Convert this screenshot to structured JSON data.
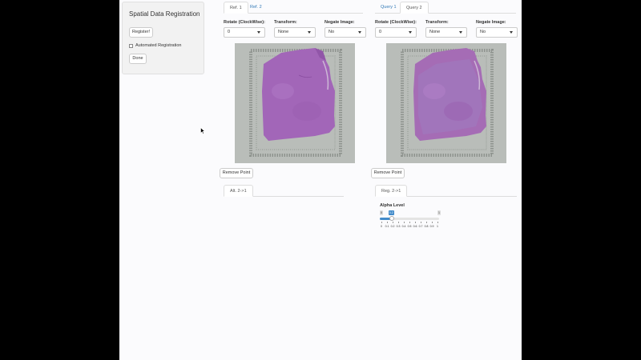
{
  "sidebar": {
    "title": "Spatial Data Registration",
    "register_label": "Register!",
    "automated_label": "Automated Registration",
    "done_label": "Done"
  },
  "reference": {
    "tabs": [
      "Ref. 1",
      "Ref. 2"
    ],
    "active_tab": 0,
    "rotate_label": "Rotate (ClockWise):",
    "rotate_value": "0",
    "transform_label": "Transform:",
    "transform_value": "None",
    "negate_label": "Negate Image:",
    "negate_value": "No",
    "remove_point_label": "Remove Point",
    "result_tab": "Alt. 2->1"
  },
  "query": {
    "tabs": [
      "Query 1",
      "Query 2"
    ],
    "active_tab": 1,
    "rotate_label": "Rotate (ClockWise):",
    "rotate_value": "0",
    "transform_label": "Transform:",
    "transform_value": "None",
    "negate_label": "Negate Image:",
    "negate_value": "No",
    "remove_point_label": "Remove Point",
    "result_tab": "Reg. 2->1"
  },
  "alpha_slider": {
    "label": "Alpha Level",
    "min_label": "0",
    "max_label": "1",
    "value_label": "0.2",
    "value": 0.2,
    "ticks": [
      "0",
      "0.1",
      "0.2",
      "0.3",
      "0.4",
      "0.5",
      "0.6",
      "0.7",
      "0.8",
      "0.9",
      "1"
    ]
  },
  "colors": {
    "accent": "#428bca",
    "link": "#337ab7",
    "tissue": "#a266b8",
    "slide_bg": "#b9bdb9"
  }
}
